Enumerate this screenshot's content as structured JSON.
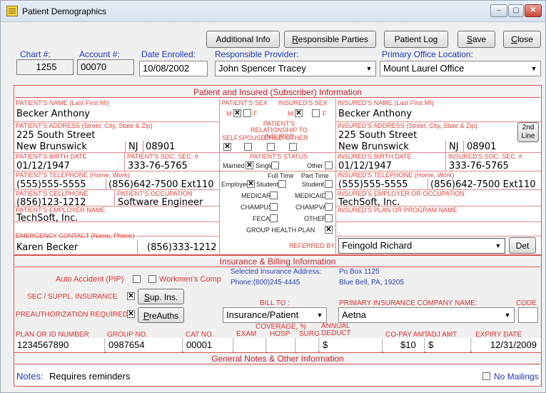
{
  "window": {
    "title": "Patient Demographics",
    "controls": [
      "‒",
      "▢",
      "✕"
    ]
  },
  "toolbar": {
    "additional_info": "Additional Info",
    "responsible_parties": "Responsible Parties",
    "patient_log": "Patient Log",
    "save": "Save",
    "close": "Close"
  },
  "header": {
    "chart_label": "Chart #:",
    "chart_value": "1255",
    "account_label": "Account #:",
    "account_value": "00070",
    "enrolled_label": "Date Enrolled:",
    "enrolled_value": "10/08/2002",
    "provider_label": "Responsible Provider:",
    "provider_value": "John Spencer Tracey",
    "office_label": "Primary Office Location:",
    "office_value": "Mount Laurel Office"
  },
  "patient_section": {
    "heading": "Patient and Insured (Subscriber) Information",
    "name_label": "PATIENT'S NAME (Last First MI)",
    "name_value": "Becker Anthony",
    "sex_label": "PATIENT'S SEX",
    "ins_sex_label": "INSURED'S SEX",
    "sex_m": "M",
    "sex_f": "F",
    "ins_name_label": "INSURED'S NAME (Last First MI)",
    "ins_name_value": "Becker Anthony",
    "address_label": "PATIENT'S ADDRESS (Street, City, State & Zip)",
    "street": "225 South Street",
    "city": "New Brunswick",
    "state": "NJ",
    "zip": "08901",
    "relationship_label": "PATIENT'S RELATIONSHIP TO INSURED",
    "rel_self": "SELF",
    "rel_spouse": "SPOUSE",
    "rel_child": "CHILD",
    "rel_other": "OTHER",
    "ins_address_label": "INSURED'S ADDRESS (Street, City, State & Zip)",
    "ins_street": "225 South Street",
    "ins_city": "New Brunswick",
    "ins_state": "NJ",
    "ins_zip": "08901",
    "second_line": "2nd Line",
    "birth_label": "PATIENT'S BIRTH DATE",
    "birth_value": "01/12/1947",
    "ssn_label": "PATIENT'S SOC. SEC. #",
    "ssn_value": "333-76-5765",
    "status_label": "PATIENT'S STATUS",
    "married": "Married",
    "single": "Single",
    "other": "Other",
    "ins_birth_label": "INSURED'S BIRTH DATE",
    "ins_birth_value": "01/12/1947",
    "ins_ssn_label": "INSURED'S SOC. SEC. #",
    "ins_ssn_value": "333-76-5765",
    "phone_label": "PATIENT'S TELEPHONE (Home, Work)",
    "phone_home": "(555)555-5555",
    "phone_work": "(856)642-7500  Ext110",
    "full_time": "Full Time",
    "part_time": "Part Time",
    "employed": "Employed",
    "student": "Student",
    "ins_phone_label": "INSURED'S TELEPHONE (Home, Work)",
    "ins_phone_home": "(555)555-5555",
    "ins_phone_work": "(856)642-7500  Ext110",
    "cell_label": "PATIENT'S CELLPHONE",
    "cell_value": "(856)123-1212",
    "occupation_label": "PATIENT'S OCCUPATION",
    "occupation_value": "Software Engineer",
    "medicare": "MEDICARE",
    "medicaid": "MEDICAID",
    "champus": "CHAMPUS",
    "champva": "CHAMPVA",
    "feca": "FECA",
    "other_ins": "OTHER",
    "group_health": "GROUP HEALTH PLAN",
    "ins_employer_label": "INSURED'S EMPLOYER OR OCCUPATION",
    "ins_employer_value": "TechSoft, Inc.",
    "employer_label": "PATIENT'S EMPLOYER NAME",
    "employer_value": "TechSoft, Inc.",
    "plan_label": "INSURED'S PLAN OR PROGRAM NAME",
    "emergency_label": "EMERGENCY CONTACT (Name, Phone)",
    "emergency_name": "Karen Becker",
    "emergency_phone": "(856)333-1212",
    "referred_label": "REFERRED BY:",
    "referred_value": "Feingold Richard",
    "det": "Det"
  },
  "insurance_section": {
    "heading": "Insurance & Billing Information",
    "auto_accident": "Auto Accident (PIP)",
    "workmens_comp": "Workmen's Comp",
    "selected_label": "Selected Insurance Address:",
    "selected_phone": "Phone:(800)245-4445",
    "addr1": "Po Box 1125",
    "addr2": "Blue Bell, PA, 19205",
    "sec_label": "SEC / SUPPL. INSURANCE",
    "sup_ins": "Sup. Ins.",
    "preauth_label": "PREAUTHORIZATION REQUIRED",
    "preauths": "PreAuths",
    "bill_to_label": "BILL TO :",
    "bill_to_value": "Insurance/Patient",
    "primary_label": "PRIMARY INSURANCE COMPANY NAME:",
    "primary_value": "Aetna",
    "code_label": "CODE",
    "plan_id_label": "PLAN OR ID NUMBER",
    "plan_id_value": "1234567890",
    "group_label": "GROUP NO.",
    "group_value": "0987654",
    "cat_label": "CAT NO.",
    "cat_value": "00001",
    "coverage_label": "COVERAGE, %",
    "exam": "EXAM",
    "hosp": "HOSP",
    "surg": "SURG",
    "deduct_label": "ANNUAL DEDUCT",
    "deduct_value": "$",
    "copay_label": "CO-PAY AMT",
    "copay_value": "$10",
    "adj_label": "ADJ AMT",
    "adj_value": "$",
    "expiry_label": "EXPIRY DATE",
    "expiry_value": "12/31/2009"
  },
  "notes_section": {
    "heading": "General Notes & Other Information",
    "notes_label": "Notes:",
    "notes_value": "Requires reminders",
    "no_mailings": "No Mailings"
  }
}
